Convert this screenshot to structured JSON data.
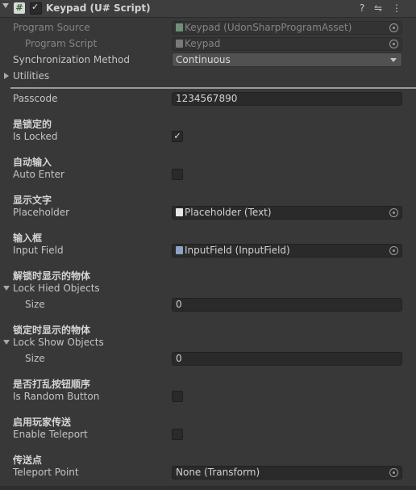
{
  "header": {
    "script_icon": "#",
    "title": "Keypad (U# Script)",
    "help_icon": "?",
    "settings_icon": "⇋",
    "menu_icon": "⋮"
  },
  "program_source": {
    "label": "Program Source",
    "value": "Keypad (UdonSharpProgramAsset)"
  },
  "program_script": {
    "label": "Program Script",
    "value": "Keypad"
  },
  "sync_method": {
    "label": "Synchronization Method",
    "value": "Continuous"
  },
  "utilities": {
    "label": "Utilities"
  },
  "passcode": {
    "label": "Passcode",
    "value": "1234567890"
  },
  "is_locked": {
    "header": "是锁定的",
    "label": "Is Locked",
    "checked": true,
    "check_glyph": "✓"
  },
  "auto_enter": {
    "header": "自动输入",
    "label": "Auto Enter",
    "checked": false
  },
  "placeholder": {
    "header": "显示文字",
    "label": "Placeholder",
    "value": "Placeholder (Text)"
  },
  "input_field": {
    "header": "输入框",
    "label": "Input Field",
    "value": "InputField (InputField)"
  },
  "lock_hide_objects": {
    "header": "解锁时显示的物体",
    "label": "Lock Hied Objects",
    "size_label": "Size",
    "size_value": "0"
  },
  "lock_show_objects": {
    "header": "锁定时显示的物体",
    "label": "Lock Show Objects",
    "size_label": "Size",
    "size_value": "0"
  },
  "random_button": {
    "header": "是否打乱按钮顺序",
    "label": "Is Random Button",
    "checked": false
  },
  "enable_teleport": {
    "header": "启用玩家传送",
    "label": "Enable Teleport",
    "checked": false
  },
  "teleport_point": {
    "header": "传送点",
    "label": "Teleport Point",
    "value": "None (Transform)"
  },
  "colors": {
    "background": "#383838",
    "field": "#2a2a2a",
    "text_icon": "#e8e8e8",
    "input_icon": "#8aa4c8",
    "asset_icon": "#6f8f76"
  }
}
